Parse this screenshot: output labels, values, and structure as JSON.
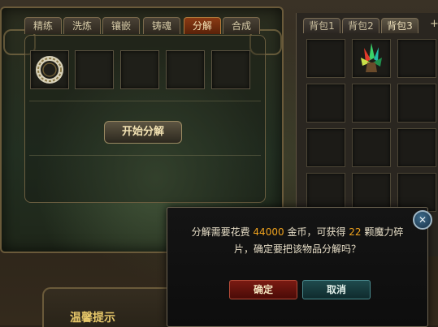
{
  "left_tabs": [
    "精练",
    "洗炼",
    "镶嵌",
    "铸魂",
    "分解",
    "合成"
  ],
  "active_left_tab": "分解",
  "start_button": "开始分解",
  "bag_tabs": [
    "背包1",
    "背包2",
    "背包3"
  ],
  "active_bag_tab": "背包3",
  "bag_plus": "+",
  "tip_title": "温馨提示",
  "dialog": {
    "line1_prefix": "分解需要花费",
    "cost": "44000",
    "line1_middle": "金币，可获得",
    "count": "22",
    "line1_suffix": "颗魔力碎",
    "line2": "片，确定要把该物品分解吗？",
    "confirm": "确定",
    "cancel": "取消",
    "close": "✕"
  },
  "icons": {
    "equip_slot_item": "ring-icon",
    "bag_slot_item": "crystal-cluster-icon"
  }
}
